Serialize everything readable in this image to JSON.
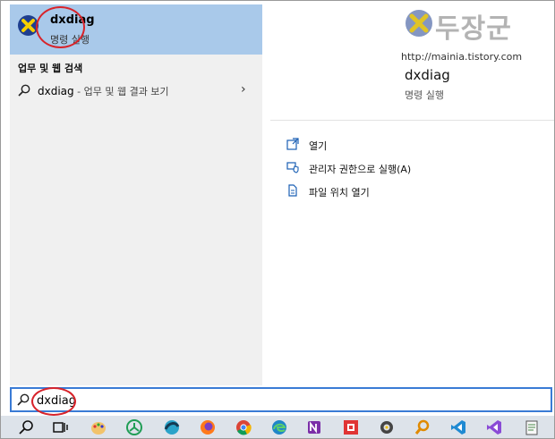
{
  "best_match": {
    "title": "dxdiag",
    "subtitle": "명령 실행"
  },
  "web_section": {
    "header": "업무 및 웹 검색",
    "query": "dxdiag",
    "suffix": " - 업무 및 웹 결과 보기"
  },
  "detail": {
    "watermark": "두장군",
    "watermark_url": "http://mainia.tistory.com",
    "title": "dxdiag",
    "subtitle": "명령 실행",
    "actions": [
      {
        "label": "열기",
        "icon": "open-icon"
      },
      {
        "label": "관리자 권한으로 실행(A)",
        "icon": "shield-icon"
      },
      {
        "label": "파일 위치 열기",
        "icon": "file-location-icon"
      }
    ]
  },
  "search": {
    "value": "dxdiag"
  },
  "taskbar": {
    "items": [
      "search-icon",
      "task-view-icon",
      "paint-icon",
      "network-icon",
      "browser-icon",
      "firefox-icon",
      "chrome-icon",
      "edge-icon",
      "onenote-icon",
      "red-app-icon",
      "tool-icon",
      "magnifier-icon",
      "vscode-icon",
      "visual-studio-icon",
      "notepad-icon"
    ]
  },
  "colors": {
    "selection": "#a9c9ea",
    "accent": "#3a7bd5",
    "annotation": "#d8232a"
  }
}
